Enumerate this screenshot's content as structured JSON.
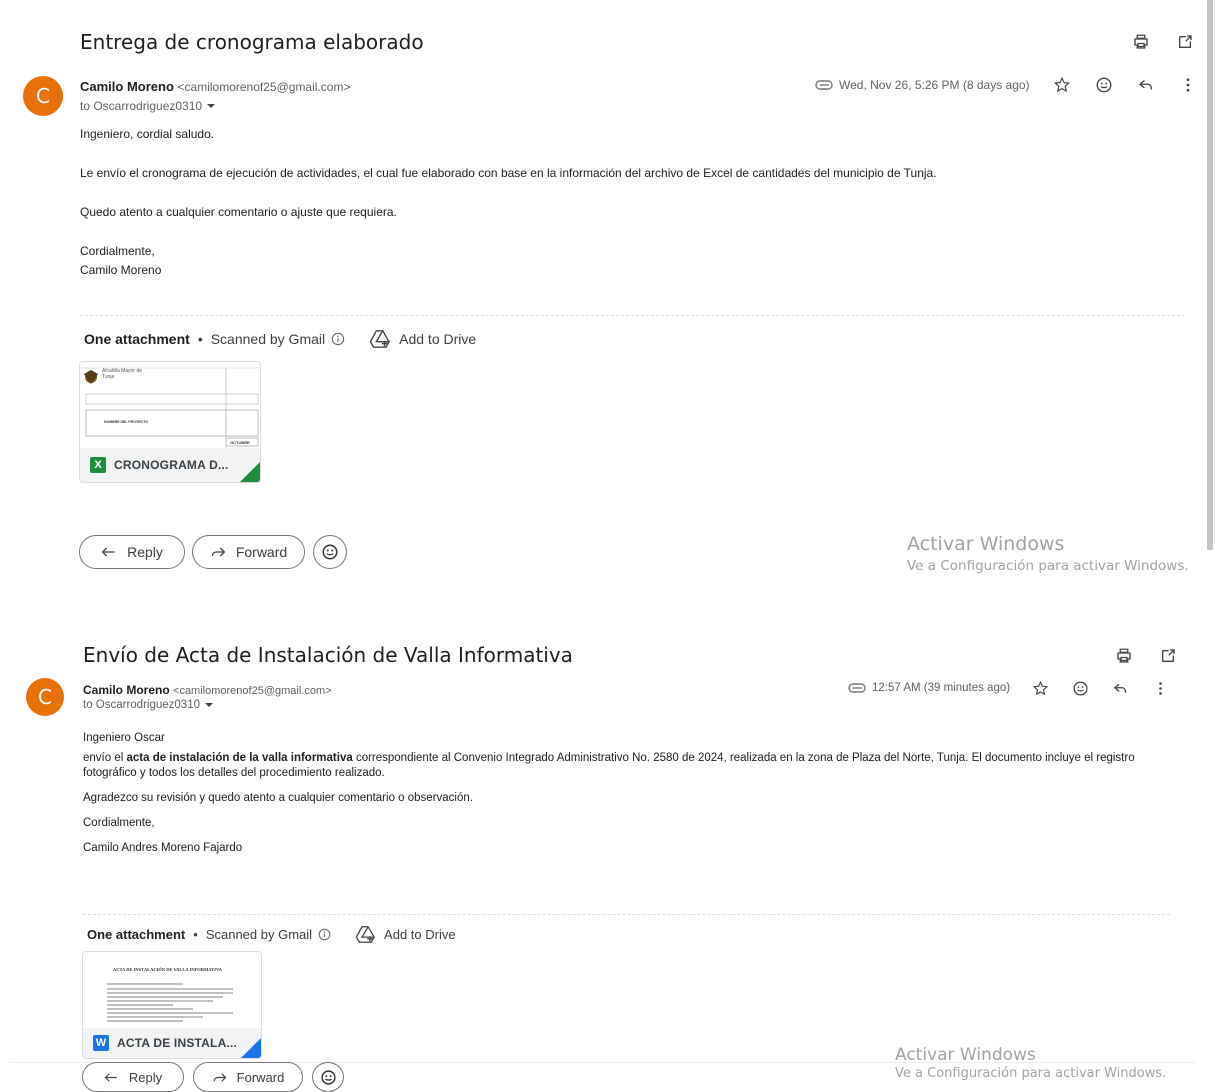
{
  "emails": [
    {
      "subject": "Entrega de cronograma elaborado",
      "sender_name": "Camilo Moreno",
      "sender_email": "<camilomorenof25@gmail.com>",
      "avatar_letter": "C",
      "to": "to Oscarrodriguez0310",
      "date": "Wed, Nov 26, 5:26 PM (8 days ago)",
      "body": [
        "Ingeniero, cordial saludo.",
        "Le envío el cronograma de ejecución de actividades, el cual fue elaborado con base en la información del archivo de Excel de cantidades del municipio de Tunja.",
        "Quedo atento a cualquier comentario o ajuste que requiera.",
        "Cordialmente,",
        "Camilo Moreno"
      ],
      "attachment": {
        "header": "One attachment",
        "scanned": "Scanned by Gmail",
        "add_to_drive": "Add to Drive",
        "file_label": "CRONOGRAMA D...",
        "file_type": "X",
        "file_color": "#1e8e3e",
        "thumb_org": "Alcaldía Mayor de Tunja",
        "thumb_row": "NOMBRE DEL PROYECTO",
        "thumb_cell": "OCTUBRE"
      },
      "reply_label": "Reply",
      "forward_label": "Forward"
    },
    {
      "subject": "Envío de Acta de Instalación de Valla Informativa",
      "sender_name": "Camilo Moreno",
      "sender_email": "<camilomorenof25@gmail.com>",
      "avatar_letter": "C",
      "to": "to Oscarrodriguez0310",
      "date": "12:57 AM (39 minutes ago)",
      "body": {
        "greeting": "Ingeniero Oscar",
        "p1_start": "envío el ",
        "p1_bold": "acta de instalación de la valla informativa",
        "p1_rest": " correspondiente al Convenio Integrado Administrativo No. 2580 de 2024, realizada en la zona de Plaza del Norte, Tunja. El documento incluye el registro fotográfico y todos los detalles del procedimiento realizado.",
        "p2": "Agradezco su revisión y quedo atento a cualquier comentario o observación.",
        "p3": "Cordialmente,",
        "p4": "Camilo Andres Moreno Fajardo"
      },
      "attachment": {
        "header": "One attachment",
        "scanned": "Scanned by Gmail",
        "add_to_drive": "Add to Drive",
        "file_label": "ACTA DE INSTALA...",
        "file_type": "W",
        "file_color": "#1a73e8",
        "thumb_title": "ACTA DE INSTALACIÓN DE VALLA INFORMATIVA"
      },
      "reply_label": "Reply",
      "forward_label": "Forward"
    }
  ],
  "watermark": {
    "title": "Activar Windows",
    "subtitle": "Ve a Configuración para activar Windows."
  }
}
